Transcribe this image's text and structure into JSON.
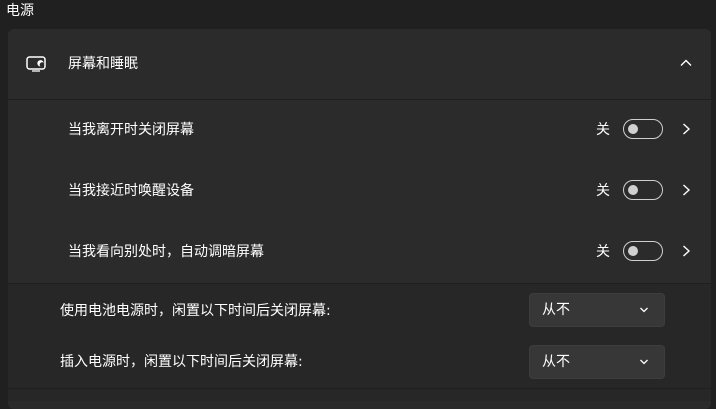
{
  "section": {
    "title": "电源"
  },
  "screen_sleep": {
    "label": "屏幕和睡眠",
    "icon": "screen-sleep-icon",
    "expanded": true
  },
  "toggle_rows": [
    {
      "label": "当我离开时关闭屏幕",
      "state": "关",
      "on": false
    },
    {
      "label": "当我接近时唤醒设备",
      "state": "关",
      "on": false
    },
    {
      "label": "当我看向别处时，自动调暗屏幕",
      "state": "关",
      "on": false
    }
  ],
  "dropdown_rows": [
    {
      "label": "使用电池电源时，闲置以下时间后关闭屏幕:",
      "value": "从不"
    },
    {
      "label": "插入电源时，闲置以下时间后关闭屏幕:",
      "value": "从不"
    }
  ],
  "colors": {
    "background": "#202020",
    "card": "#2b2b2b",
    "dropdown": "#373737",
    "text": "#ffffff"
  }
}
